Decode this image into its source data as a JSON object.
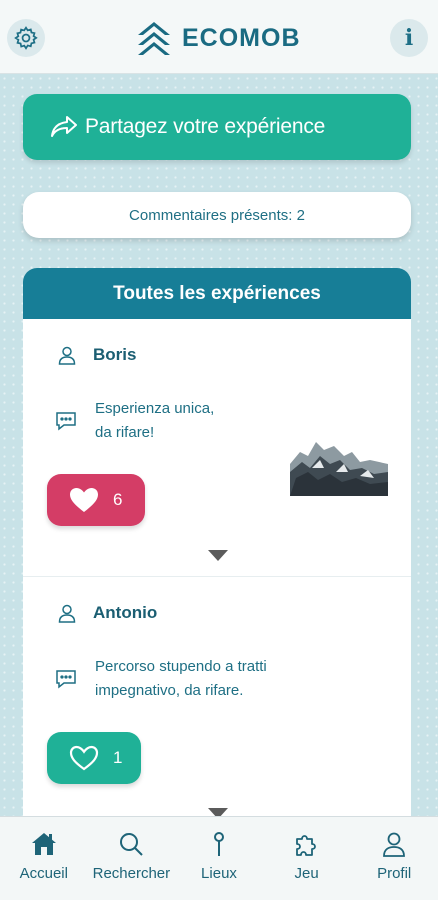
{
  "header": {
    "logo_text": "ECOMOB",
    "info_glyph": "i",
    "settings_icon": "gear-icon",
    "brand_color": "#1a6b82"
  },
  "share": {
    "label": "Partagez votre expérience",
    "icon": "share-arrow-icon",
    "color": "#1fb197"
  },
  "comments": {
    "label": "Commentaires présents: 2"
  },
  "experiences": {
    "title": "Toutes les expériences",
    "header_color": "#177e97",
    "items": [
      {
        "user": "Boris",
        "comment_lines": [
          "Esperienza unica,",
          "da rifare!"
        ],
        "likes": "6",
        "liked": true,
        "has_photo": true,
        "like_color": "#d43d66"
      },
      {
        "user": "Antonio",
        "comment_lines": [
          "Percorso stupendo a tratti",
          "impegnativo, da rifare."
        ],
        "likes": "1",
        "liked": false,
        "has_photo": false,
        "like_color": "#1fb197"
      }
    ]
  },
  "tabbar": {
    "items": [
      {
        "label": "Accueil",
        "icon": "home-icon"
      },
      {
        "label": "Rechercher",
        "icon": "search-icon"
      },
      {
        "label": "Lieux",
        "icon": "map-pin-icon"
      },
      {
        "label": "Jeu",
        "icon": "puzzle-icon"
      },
      {
        "label": "Profil",
        "icon": "user-icon"
      }
    ]
  }
}
